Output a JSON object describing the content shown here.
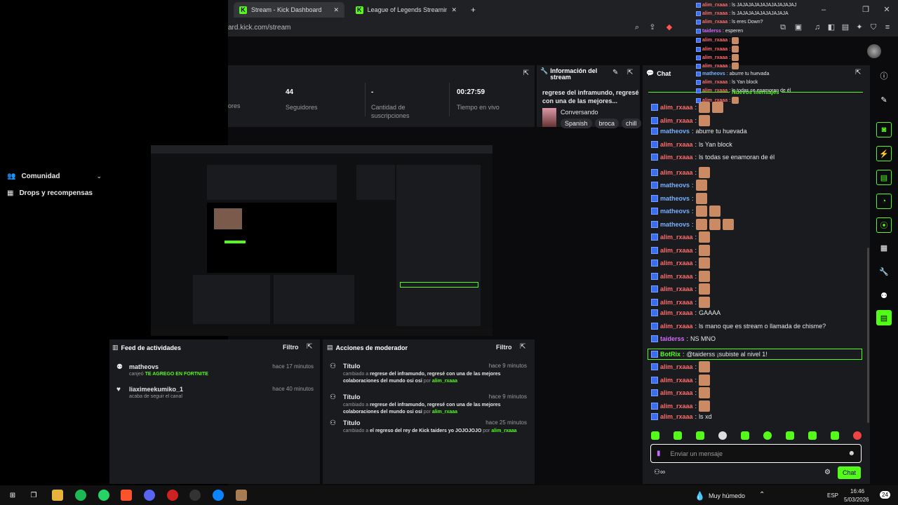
{
  "browser": {
    "tabs": [
      {
        "label": "Stream - Kick Dashboard",
        "active": true
      },
      {
        "label": "League of Legends Streaming - Live S",
        "active": false
      }
    ],
    "url": "ard.kick.com/stream",
    "ext_badge": "1"
  },
  "left_menu": {
    "items": [
      {
        "label": "Comunidad",
        "icon": "people-icon"
      },
      {
        "label": "Drops y recompensas",
        "icon": "gift-icon"
      }
    ]
  },
  "stats": [
    {
      "value": "",
      "label": "ores"
    },
    {
      "value": "44",
      "label": "Seguidores"
    },
    {
      "value": "-",
      "label": "Cantidad de suscripciones"
    },
    {
      "value": "00:27:59",
      "label": "Tiempo en vivo"
    }
  ],
  "stream_info": {
    "title": "Información del stream",
    "stream_title": "regrese del inframundo, regresé con una de las mejores...",
    "category": "Conversando",
    "tags": [
      "Spanish",
      "broca",
      "chill"
    ]
  },
  "activity_feed": {
    "title": "Feed de actividades",
    "filter": "Filtro",
    "items": [
      {
        "user": "matheovs",
        "prefix": "canjeó",
        "highlight": "TE AGREGO EN FORTNITE",
        "time": "hace 17 minutos"
      },
      {
        "user": "liaximeekumiko_1",
        "prefix": "acaba de seguir el canal",
        "highlight": "",
        "time": "hace 40 minutos"
      }
    ]
  },
  "mod_actions": {
    "title": "Acciones de moderador",
    "filter": "Filtro",
    "items": [
      {
        "title": "Título",
        "time": "hace 9 minutos",
        "pre": "cambiado a",
        "text": "regrese del inframundo, regresé con una de las mejores colaboraciones del mundo osi osi",
        "by": "por",
        "user": "alim_rxaaa"
      },
      {
        "title": "Título",
        "time": "hace 9 minutos",
        "pre": "cambiado a",
        "text": "regrese del inframundo, regresé con una de las mejores colaboraciones del mundo osi osi",
        "by": "por",
        "user": "alim_rxaaa"
      },
      {
        "title": "Título",
        "time": "hace 25 minutos",
        "pre": "cambiado a",
        "text": "el regreso del rey de Kick taiders yo JOJOJOJO",
        "by": "por",
        "user": "alim_rxaaa"
      }
    ]
  },
  "chat": {
    "title": "Chat",
    "new_messages": "Nuevos mensajes",
    "messages": [
      {
        "user": "alim_rxaaa",
        "color": "r",
        "text": "",
        "emotes": 2
      },
      {
        "user": "alim_rxaaa",
        "color": "r",
        "text": "",
        "emotes": 1
      },
      {
        "user": "matheovs",
        "color": "b",
        "text": "aburre tu huevada",
        "emotes": 0
      },
      {
        "user": "alim_rxaaa",
        "color": "r",
        "text": "ls Yan block",
        "emotes": 0
      },
      {
        "user": "alim_rxaaa",
        "color": "r",
        "text": "ls todas se enamoran de él",
        "emotes": 0
      },
      {
        "user": "alim_rxaaa",
        "color": "r",
        "text": "",
        "emotes": 1
      },
      {
        "user": "matheovs",
        "color": "b",
        "text": "",
        "emotes": 1
      },
      {
        "user": "matheovs",
        "color": "b",
        "text": "",
        "emotes": 1
      },
      {
        "user": "matheovs",
        "color": "b",
        "text": "",
        "emotes": 2
      },
      {
        "user": "matheovs",
        "color": "b",
        "text": "",
        "emotes": 3
      },
      {
        "user": "alim_rxaaa",
        "color": "r",
        "text": "",
        "emotes": 1
      },
      {
        "user": "alim_rxaaa",
        "color": "r",
        "text": "",
        "emotes": 1
      },
      {
        "user": "alim_rxaaa",
        "color": "r",
        "text": "",
        "emotes": 1
      },
      {
        "user": "alim_rxaaa",
        "color": "r",
        "text": "",
        "emotes": 1
      },
      {
        "user": "alim_rxaaa",
        "color": "r",
        "text": "",
        "emotes": 1
      },
      {
        "user": "alim_rxaaa",
        "color": "r",
        "text": "",
        "emotes": 1
      },
      {
        "user": "alim_rxaaa",
        "color": "r",
        "text": "GAAAA",
        "emotes": 0
      },
      {
        "user": "alim_rxaaa",
        "color": "r",
        "text": "ls mano que es stream o llamada de chisme?",
        "emotes": 0
      },
      {
        "user": "taiderss",
        "color": "p",
        "text": "NS MNO",
        "emotes": 0
      },
      {
        "user": "BotRix",
        "color": "g",
        "text": "@taiderss ¡subiste al nivel 1!",
        "emotes": 0,
        "bot": true
      },
      {
        "user": "alim_rxaaa",
        "color": "r",
        "text": "",
        "emotes": 1
      },
      {
        "user": "alim_rxaaa",
        "color": "r",
        "text": "",
        "emotes": 1
      },
      {
        "user": "alim_rxaaa",
        "color": "r",
        "text": "",
        "emotes": 1
      },
      {
        "user": "alim_rxaaa",
        "color": "r",
        "text": "",
        "emotes": 1
      },
      {
        "user": "alim_rxaaa",
        "color": "r",
        "text": "ls xd",
        "emotes": 0
      }
    ],
    "input_placeholder": "Enviar un mensaje",
    "send_label": "Chat"
  },
  "overlay_chat": [
    {
      "user": "alim_rxaaa",
      "text": "ls JAJAJAJAJAJAJAJAJAJAJ"
    },
    {
      "user": "alim_rxaaa",
      "text": "ls JAJAJAJAJAJAJAJAJA"
    },
    {
      "user": "alim_rxaaa",
      "text": "ls eres Down?"
    },
    {
      "user": "taiderss",
      "text": "esperen"
    },
    {
      "user": "alim_rxaaa",
      "text": ""
    },
    {
      "user": "alim_rxaaa",
      "text": ""
    },
    {
      "user": "alim_rxaaa",
      "text": ""
    },
    {
      "user": "alim_rxaaa",
      "text": ""
    },
    {
      "user": "matheovs",
      "text": "aburre tu huevada"
    },
    {
      "user": "alim_rxaaa",
      "text": "ls Yan block"
    },
    {
      "user": "alim_rxaaa",
      "text": "ls todas se enamoran de él"
    },
    {
      "user": "alim_rxaaa",
      "text": ""
    }
  ],
  "taskbar": {
    "weather": "Muy húmedo",
    "lang": "ESP",
    "time": "16:46",
    "date": "5/03/2026",
    "notif": "24"
  }
}
